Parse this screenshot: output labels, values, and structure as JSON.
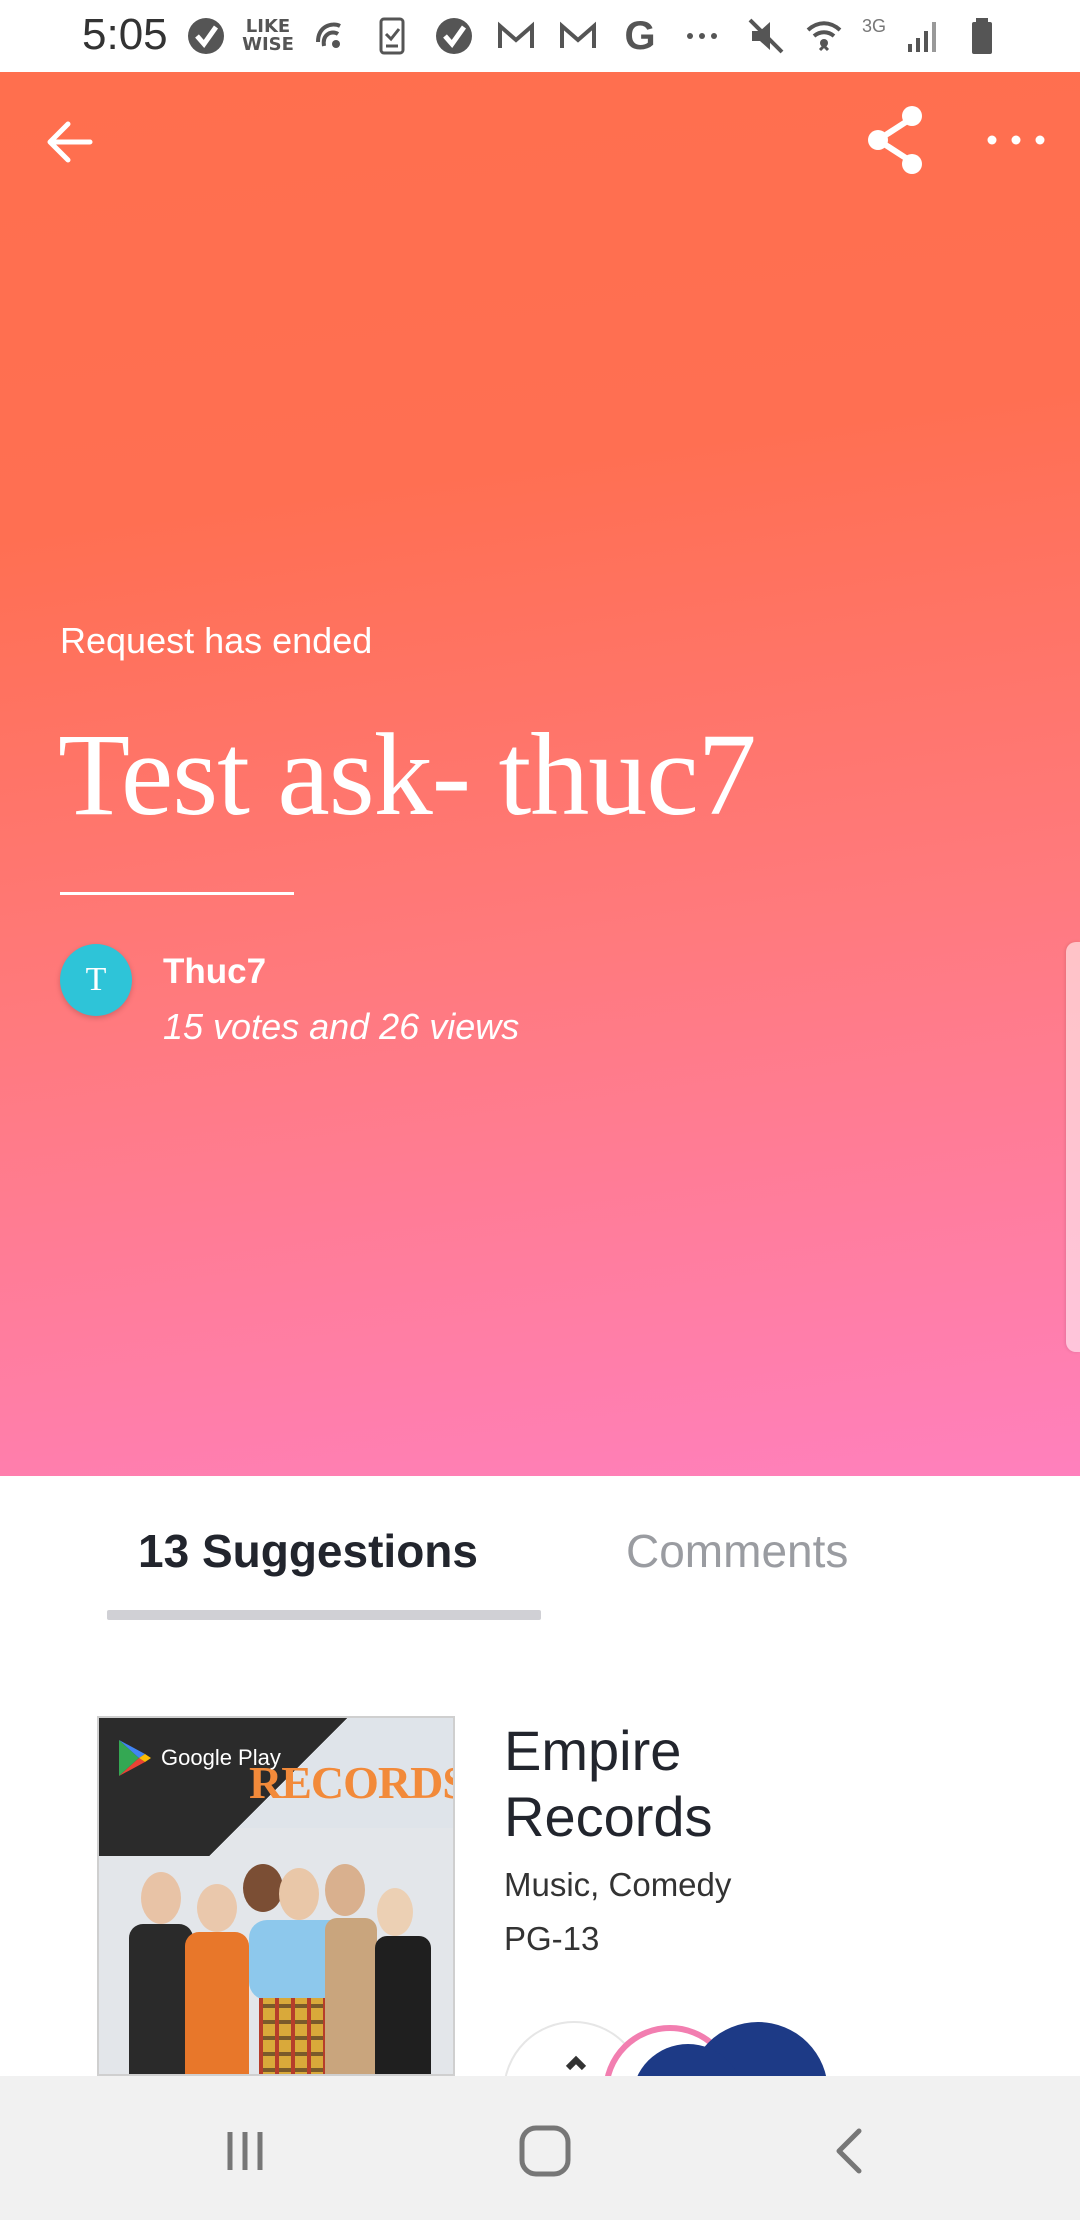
{
  "status_bar": {
    "time": "5:05",
    "likewise_label": "LIKE\nWISE",
    "g_label": "G",
    "network_label": "3G"
  },
  "hero": {
    "status": "Request has ended",
    "title": "Test ask- thuc7",
    "author_initial": "T",
    "author_name": "Thuc7",
    "stats": "15 votes and 26 views",
    "colors": {
      "top": "#ff6f4e",
      "bottom": "#ff80bd",
      "avatar": "#2ec4d8"
    }
  },
  "tabs": {
    "suggestions": "13 Suggestions",
    "comments": "Comments",
    "active": "suggestions"
  },
  "suggestion": {
    "poster_badge": "Google Play",
    "poster_title": "RECORDS",
    "title": "Empire Records",
    "genre": "Music, Comedy",
    "rating": "PG-13"
  },
  "icons": {
    "back": "arrow-left-icon",
    "share": "share-icon",
    "more": "more-horizontal-icon",
    "nav_recents": "recents-icon",
    "nav_home": "home-icon",
    "nav_back": "chevron-left-icon"
  }
}
